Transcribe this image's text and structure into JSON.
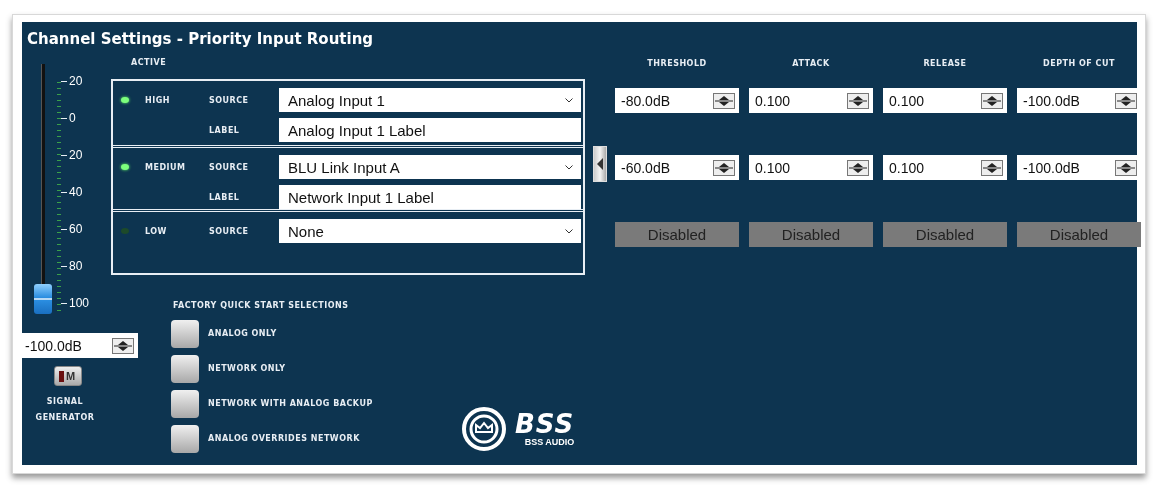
{
  "title": "Channel Settings - Priority Input Routing",
  "fader": {
    "scale": [
      "20",
      "0",
      "20",
      "40",
      "60",
      "80",
      "100"
    ],
    "level": 0,
    "value": "-100.0dB"
  },
  "mute_button": {
    "label": "M",
    "on": false
  },
  "signal_generator_label": "SIGNAL GENERATOR",
  "active_heading": "ACTIVE",
  "columns": [
    "THRESHOLD",
    "ATTACK",
    "RELEASE",
    "DEPTH OF CUT"
  ],
  "priorities": [
    {
      "name": "HIGH",
      "active": true,
      "source_caption": "SOURCE",
      "source": "Analog Input 1",
      "label_caption": "LABEL",
      "label": "Analog Input 1 Label",
      "disabled": false,
      "params": [
        "-80.0dB",
        "0.100",
        "0.100",
        "-100.0dB"
      ]
    },
    {
      "name": "MEDIUM",
      "active": true,
      "source_caption": "SOURCE",
      "source": "BLU Link Input A",
      "label_caption": "LABEL",
      "label": "Network Input 1 Label",
      "disabled": false,
      "params": [
        "-60.0dB",
        "0.100",
        "0.100",
        "-100.0dB"
      ]
    },
    {
      "name": "LOW",
      "active": false,
      "source_caption": "SOURCE",
      "source": "None",
      "disabled": true,
      "params": [
        "Disabled",
        "Disabled",
        "Disabled",
        "Disabled"
      ]
    }
  ],
  "quick_start": {
    "heading": "FACTORY QUICK START SELECTIONS",
    "options": [
      "ANALOG ONLY",
      "NETWORK ONLY",
      "NETWORK WITH ANALOG BACKUP",
      "ANALOG OVERRIDES NETWORK"
    ]
  },
  "logo": {
    "mark": "BSS",
    "caption": "BSS AUDIO"
  }
}
